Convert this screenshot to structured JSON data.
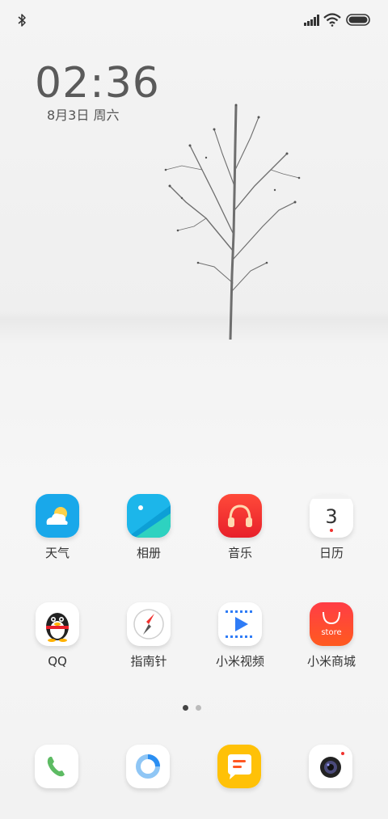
{
  "status_bar": {
    "bluetooth_icon": "bluetooth-icon",
    "signal_icon": "cellular-signal-icon",
    "wifi_icon": "wifi-icon",
    "battery_icon": "battery-icon"
  },
  "lockscreen": {
    "time": "02:36",
    "date": "8月3日 周六"
  },
  "apps_row1": [
    {
      "label": "天气",
      "icon": "weather-icon",
      "color": "#1aa9ea"
    },
    {
      "label": "相册",
      "icon": "gallery-icon",
      "color": "#1bb3e8"
    },
    {
      "label": "音乐",
      "icon": "music-icon",
      "color": "#f0322f"
    },
    {
      "label": "日历",
      "icon": "calendar-icon",
      "color": "#ffffff",
      "day": "3"
    }
  ],
  "apps_row2": [
    {
      "label": "QQ",
      "icon": "qq-penguin-icon",
      "color": "#ffffff"
    },
    {
      "label": "指南针",
      "icon": "compass-icon",
      "color": "#ffffff"
    },
    {
      "label": "小米视频",
      "icon": "video-play-icon",
      "color": "#ffffff"
    },
    {
      "label": "小米商城",
      "icon": "mi-store-icon",
      "color": "#f0322f",
      "badge_text": "store"
    }
  ],
  "pagination": {
    "pages": 2,
    "current": 1
  },
  "dock": [
    {
      "icon": "phone-icon",
      "color": "#4caf50"
    },
    {
      "icon": "browser-icon",
      "color": "#2196f3"
    },
    {
      "icon": "messages-icon",
      "color": "#ffc400"
    },
    {
      "icon": "camera-icon",
      "color": "#333333"
    }
  ]
}
